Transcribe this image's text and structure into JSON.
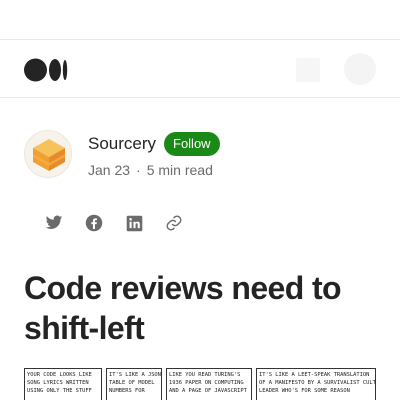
{
  "brand": {
    "name": "Medium",
    "color": "#242424"
  },
  "author": {
    "name": "Sourcery",
    "follow_label": "Follow",
    "date": "Jan 23",
    "separator": "·",
    "read_time": "5 min read"
  },
  "share_icons": [
    "twitter-icon",
    "facebook-icon",
    "linkedin-icon",
    "link-icon"
  ],
  "article": {
    "title": "Code reviews need to shift-left"
  },
  "comic": {
    "panels": [
      [
        "YOUR CODE LOOKS LIKE",
        "SONG LYRICS WRITTEN",
        "USING ONLY THE STUFF"
      ],
      [
        "IT'S LIKE A JSON",
        "TABLE OF MODEL",
        "NUMBERS FOR"
      ],
      [
        "LIKE YOU READ TURING'S",
        "1936 PAPER ON COMPUTING",
        "AND A PAGE OF JAVASCRIPT"
      ],
      [
        "IT'S LIKE A LEET-SPEAK TRANSLATION",
        "OF A MANIFESTO BY A SURVIVALIST CULT",
        "LEADER WHO'S FOR SOME REASON"
      ]
    ]
  },
  "colors": {
    "accent": "#1a8917",
    "text": "#242424",
    "muted": "#6b6b6b"
  }
}
